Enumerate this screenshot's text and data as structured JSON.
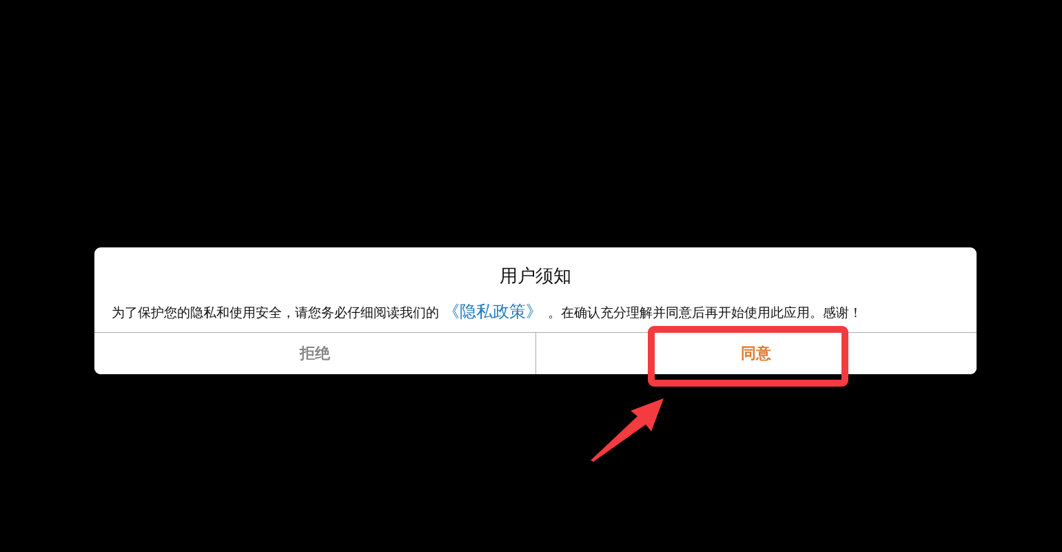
{
  "dialog": {
    "title": "用户须知",
    "message": {
      "before": "为了保护您的隐私和使用安全，请您务必仔细阅读我们的",
      "link": "《隐私政策》",
      "after": "。在确认充分理解并同意后再开始使用此应用。感谢！"
    },
    "buttons": [
      {
        "label": "拒绝",
        "kind": "cancel"
      },
      {
        "label": "同意",
        "kind": "confirm"
      }
    ]
  },
  "annotation": {
    "highlight": true,
    "arrow": true
  }
}
